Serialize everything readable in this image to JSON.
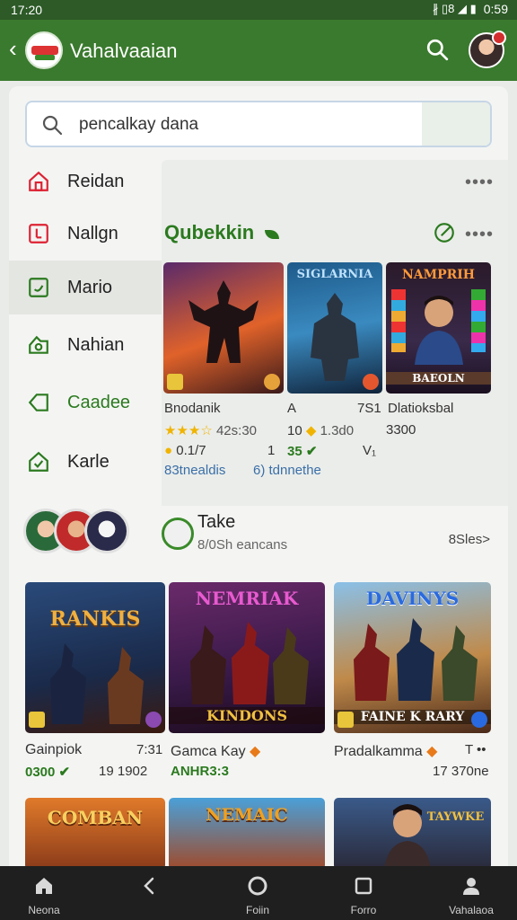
{
  "status_bar": {
    "time": "17:20",
    "glyphs": "∦ ▯8 ◢ ▮",
    "clock": "0:59"
  },
  "app_bar": {
    "title": "Vahalvaaian",
    "logo_text": ""
  },
  "search": {
    "placeholder": "pencalkay dana",
    "value": "pencalkay dana"
  },
  "sidebar": {
    "items": [
      {
        "label": "Reidan",
        "icon": "home-icon"
      },
      {
        "label": "Nallgn",
        "icon": "bookmark-icon"
      },
      {
        "label": "Mario",
        "icon": "square-icon"
      },
      {
        "label": "Nahian",
        "icon": "game-icon"
      },
      {
        "label": "Caadee",
        "icon": "diamond-icon"
      },
      {
        "label": "Karle",
        "icon": "shield-icon"
      }
    ]
  },
  "featured": {
    "title": "Qubekkin",
    "more": "••••",
    "games": [
      {
        "caption": "",
        "name": "Bnodanik",
        "rating_text": "42s:30",
        "badge": "0.1/7",
        "link": "83tnealdis"
      },
      {
        "caption": "SIGLARNIA",
        "name": "A",
        "right_num": "7S1",
        "rating_text": "10",
        "price": "35",
        "side1": "1",
        "side2": "V₁",
        "link": "6) tdnnethe",
        "extra": "1.3d0"
      },
      {
        "caption": "NAMPRIH",
        "sub": "BAEOLN",
        "name": "Dlatioksbal",
        "rating_text": "3300"
      }
    ]
  },
  "take": {
    "title": "Take",
    "subtitle": "8/0Sh eancans",
    "link": "8Sles>"
  },
  "grid": {
    "games": [
      {
        "caption": "RANKIS",
        "name": "Gainpiok",
        "right": "7:31",
        "green": "0300",
        "bottom_right": "19 1902"
      },
      {
        "caption": "NEMRIAK",
        "caption2": "KINDONS",
        "name": "Gamca Kay",
        "green": "ANHR3:3",
        "bottom_right": ""
      },
      {
        "caption": "DAVINYS",
        "caption2": "FAINE K RARY",
        "name": "Pradalkamma",
        "right": "T ••",
        "bottom_right": "17 370ne"
      }
    ],
    "row2_captions": [
      "COMBAN",
      "NEMAIC",
      "TAYWKE"
    ]
  },
  "bottom_nav": {
    "items": [
      {
        "label": "Neona",
        "icon": "home-icon"
      },
      {
        "label": "",
        "icon": "back-icon"
      },
      {
        "label": "Foiin",
        "icon": "circle-icon"
      },
      {
        "label": "Forro",
        "icon": "square-icon"
      },
      {
        "label": "Vahalaoa",
        "icon": "person-icon"
      }
    ]
  },
  "colors": {
    "brand_green": "#3a7a2e",
    "accent_green": "#2b7a1f",
    "nav_bg": "#1f1f1f"
  }
}
